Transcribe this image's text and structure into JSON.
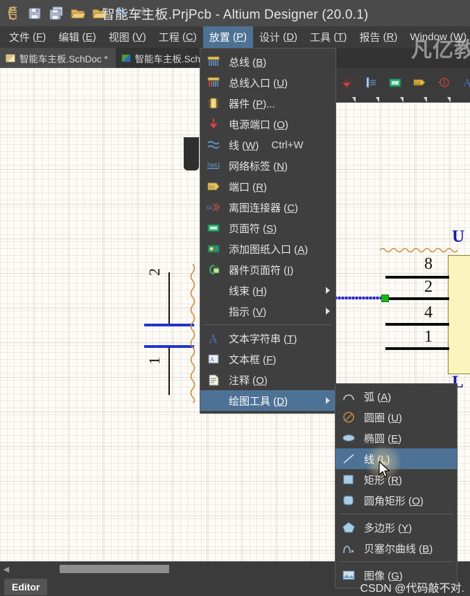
{
  "window": {
    "title": "智能车主板.PrjPcb - Altium Designer (20.0.1)",
    "watermark_brand": "凡亿教",
    "watermark_csdn": "CSDN @代码敲不对."
  },
  "quick_access": [
    {
      "name": "altium-logo-icon",
      "label": "Altium"
    },
    {
      "name": "save-icon",
      "label": "保存"
    },
    {
      "name": "save-all-icon",
      "label": "全部保存"
    },
    {
      "name": "open-icon",
      "label": "打开"
    },
    {
      "name": "open-project-icon",
      "label": "打开工程"
    },
    {
      "name": "undo-icon",
      "label": "撤销"
    },
    {
      "name": "redo-icon",
      "label": "重做"
    }
  ],
  "menubar": [
    {
      "label": "文件",
      "key": "F",
      "active": false
    },
    {
      "label": "编辑",
      "key": "E",
      "active": false
    },
    {
      "label": "视图",
      "key": "V",
      "active": false
    },
    {
      "label": "工程",
      "key": "C",
      "active": false
    },
    {
      "label": "放置",
      "key": "P",
      "active": true
    },
    {
      "label": "设计",
      "key": "D",
      "active": false
    },
    {
      "label": "工具",
      "key": "T",
      "active": false
    },
    {
      "label": "报告",
      "key": "R",
      "active": false
    },
    {
      "label": "Window",
      "key": "W",
      "active": false
    }
  ],
  "tabs": [
    {
      "label": "智能车主板.SchDoc *",
      "selected": true,
      "icon": "schematic-doc-icon"
    },
    {
      "label": "智能车主板.Sch",
      "selected": false,
      "icon": "pcb-doc-icon"
    }
  ],
  "place_menu": {
    "items": [
      {
        "label": "总线",
        "key": "B",
        "icon": "bus-icon",
        "shortcut": "",
        "submenu": false,
        "highlight": false
      },
      {
        "label": "总线入口",
        "key": "U",
        "icon": "bus-entry-icon",
        "shortcut": "",
        "submenu": false,
        "highlight": false
      },
      {
        "label": "器件",
        "key": "P",
        "suffix": "...",
        "icon": "component-icon",
        "shortcut": "",
        "submenu": false,
        "highlight": false
      },
      {
        "label": "电源端口",
        "key": "O",
        "icon": "power-port-icon",
        "shortcut": "",
        "submenu": false,
        "highlight": false
      },
      {
        "label": "线",
        "key": "W",
        "icon": "wire-icon",
        "shortcut": "Ctrl+W",
        "submenu": false,
        "highlight": false
      },
      {
        "label": "网络标签",
        "key": "N",
        "icon": "net-label-icon",
        "shortcut": "",
        "submenu": false,
        "highlight": false
      },
      {
        "label": "端口",
        "key": "R",
        "icon": "port-icon",
        "shortcut": "",
        "submenu": false,
        "highlight": false
      },
      {
        "label": "离图连接器",
        "key": "C",
        "icon": "off-sheet-connector-icon",
        "shortcut": "",
        "submenu": false,
        "highlight": false
      },
      {
        "label": "页面符",
        "key": "S",
        "icon": "sheet-symbol-icon",
        "shortcut": "",
        "submenu": false,
        "highlight": false
      },
      {
        "label": "添加图纸入口",
        "key": "A",
        "icon": "sheet-entry-icon",
        "shortcut": "",
        "submenu": false,
        "highlight": false
      },
      {
        "label": "器件页面符",
        "key": "I",
        "icon": "device-sheet-symbol-icon",
        "shortcut": "",
        "submenu": false,
        "highlight": false
      },
      {
        "label": "线束",
        "key": "H",
        "icon": "",
        "shortcut": "",
        "submenu": true,
        "highlight": false
      },
      {
        "label": "指示",
        "key": "V",
        "icon": "",
        "shortcut": "",
        "submenu": true,
        "highlight": false
      },
      {
        "separator": true
      },
      {
        "label": "文本字符串",
        "key": "T",
        "icon": "text-string-icon",
        "shortcut": "",
        "submenu": false,
        "highlight": false
      },
      {
        "label": "文本框",
        "key": "F",
        "icon": "text-frame-icon",
        "shortcut": "",
        "submenu": false,
        "highlight": false
      },
      {
        "label": "注释",
        "key": "O",
        "icon": "note-icon",
        "shortcut": "",
        "submenu": false,
        "highlight": false
      },
      {
        "label": "绘图工具",
        "key": "D",
        "icon": "",
        "shortcut": "",
        "submenu": true,
        "highlight": true
      }
    ]
  },
  "drawing_tools_menu": {
    "items": [
      {
        "label": "弧",
        "key": "A",
        "icon": "arc-icon",
        "highlight": false
      },
      {
        "label": "圆圈",
        "key": "U",
        "icon": "circle-icon",
        "highlight": false
      },
      {
        "label": "椭圆",
        "key": "E",
        "icon": "ellipse-icon",
        "highlight": false
      },
      {
        "label": "线",
        "key": "L",
        "icon": "line-icon",
        "highlight": true
      },
      {
        "label": "矩形",
        "key": "R",
        "icon": "rectangle-icon",
        "highlight": false
      },
      {
        "label": "圆角矩形",
        "key": "O",
        "icon": "rounded-rectangle-icon",
        "highlight": false
      },
      {
        "separator": true
      },
      {
        "label": "多边形",
        "key": "Y",
        "icon": "polygon-icon",
        "highlight": false
      },
      {
        "label": "贝塞尔曲线",
        "key": "B",
        "icon": "bezier-curve-icon",
        "highlight": false
      },
      {
        "separator": true
      },
      {
        "label": "图像",
        "key": "G",
        "icon": "image-icon",
        "highlight": false
      }
    ]
  },
  "schematic": {
    "capacitor": {
      "pin_top": "2",
      "pin_bottom": "1"
    },
    "component_right": {
      "designator": "U",
      "value": "L",
      "pins": [
        "8",
        "2",
        "4",
        "1"
      ]
    }
  },
  "toolbar_right": [
    {
      "name": "power-port-icon"
    },
    {
      "name": "bus-entry-icon"
    },
    {
      "name": "sheet-symbol-icon"
    },
    {
      "name": "port-icon"
    },
    {
      "name": "no-erc-icon"
    },
    {
      "name": "text-string-icon"
    }
  ],
  "statusbar": {
    "editor_label": "Editor"
  },
  "colors": {
    "menu_highlight": "#4d7296",
    "menu_bg": "#3f3f3f",
    "titlebar_bg": "#4a4a4a",
    "canvas_bg": "#fdfbf5",
    "wire_blue": "#2233cc",
    "component_fill": "#fbf4bd"
  }
}
